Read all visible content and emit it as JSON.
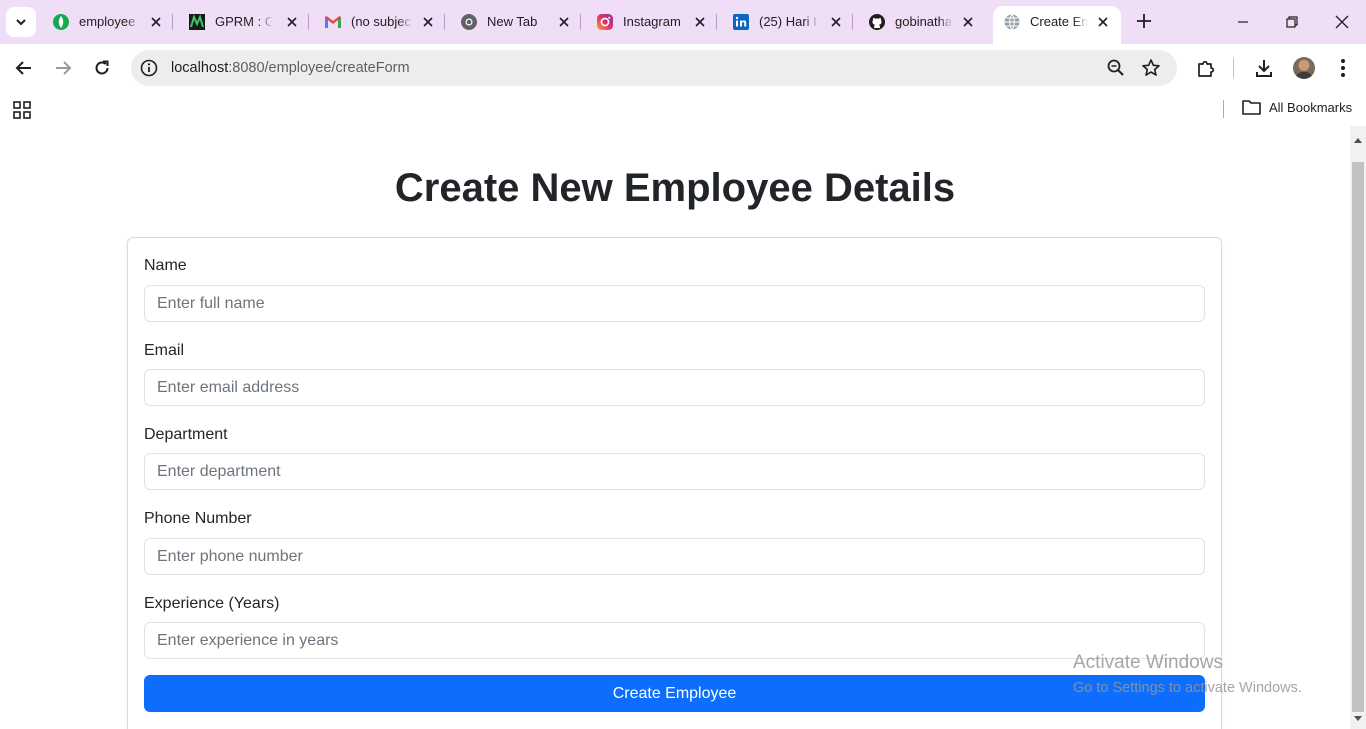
{
  "browser": {
    "tabs": [
      {
        "title": "employee",
        "icon": "green-leaf-icon"
      },
      {
        "title": "GPRM : Gi",
        "icon": "gprm-logo-icon"
      },
      {
        "title": "(no subjec",
        "icon": "gmail-icon"
      },
      {
        "title": "New Tab",
        "icon": "chrome-icon"
      },
      {
        "title": "Instagram",
        "icon": "instagram-icon"
      },
      {
        "title": "(25) Hari I",
        "icon": "linkedin-icon"
      },
      {
        "title": "gobinatha",
        "icon": "github-icon"
      },
      {
        "title": "Create Em",
        "icon": "globe-icon",
        "active": true
      }
    ],
    "address": {
      "host": "localhost",
      "path": ":8080/employee/createForm"
    },
    "bookmarks": {
      "all_label": "All Bookmarks"
    },
    "colors": {
      "tabstrip": "#f0ddf6",
      "accent": "#0d6efd"
    }
  },
  "page": {
    "title": "Create New Employee Details",
    "fields": [
      {
        "label": "Name",
        "placeholder": "Enter full name"
      },
      {
        "label": "Email",
        "placeholder": "Enter email address"
      },
      {
        "label": "Department",
        "placeholder": "Enter department"
      },
      {
        "label": "Phone Number",
        "placeholder": "Enter phone number"
      },
      {
        "label": "Experience (Years)",
        "placeholder": "Enter experience in years"
      }
    ],
    "submit_label": "Create Employee"
  },
  "watermark": {
    "line1": "Activate Windows",
    "line2": "Go to Settings to activate Windows."
  }
}
